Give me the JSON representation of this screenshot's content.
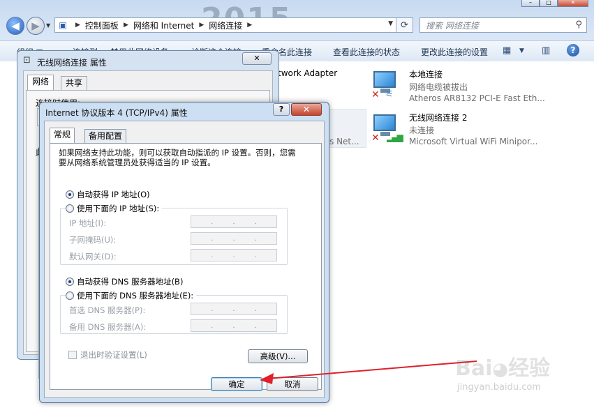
{
  "explorer": {
    "background_year": "2015",
    "address": {
      "crumbs": [
        "控制面板",
        "网络和 Internet",
        "网络连接"
      ]
    },
    "search": {
      "placeholder": "搜索 网络连接"
    },
    "toolbar": {
      "items": [
        "组织 ▼",
        "连接到",
        "禁用此网络设备",
        "诊断这个连接",
        "重命名此连接",
        "查看此连接的状态",
        "更改此连接的设置"
      ],
      "help": "?"
    },
    "adapters": [
      {
        "name": "本地连接",
        "status": "网络电缆被拔出",
        "device": "Atheros AR8132 PCI-E Fast Eth..."
      },
      {
        "name": "无线网络连接 2",
        "status": "未连接",
        "device": "Microsoft Virtual WiFi Minipor..."
      }
    ],
    "partial_adapter": {
      "line1": "twork Adapter",
      "line2": "s Net..."
    }
  },
  "wireless_dialog": {
    "title": "无线网络连接 属性",
    "tabs": [
      "网络",
      "共享"
    ],
    "connect_using_label": "连接时使用:",
    "items_label": "此"
  },
  "tcp_dialog": {
    "title": "Internet 协议版本 4 (TCP/IPv4) 属性",
    "tabs": [
      "常规",
      "备用配置"
    ],
    "description": "如果网络支持此功能，则可以获取自动指派的 IP 设置。否则，您需要从网络系统管理员处获得适当的 IP 设置。",
    "ip_auto": "自动获得 IP 地址(O)",
    "ip_manual": "使用下面的 IP 地址(S):",
    "ip_fields": [
      {
        "label": "IP 地址(I):"
      },
      {
        "label": "子网掩码(U):"
      },
      {
        "label": "默认网关(D):"
      }
    ],
    "dns_auto": "自动获得 DNS 服务器地址(B)",
    "dns_manual": "使用下面的 DNS 服务器地址(E):",
    "dns_fields": [
      {
        "label": "首选 DNS 服务器(P):"
      },
      {
        "label": "备用 DNS 服务器(A):"
      }
    ],
    "validate_label": "退出时验证设置(L)",
    "advanced_button": "高级(V)...",
    "ok_button": "确定",
    "cancel_button": "取消",
    "ip_auto_selected": true,
    "dns_auto_selected": true
  },
  "colors": {
    "annotation_arrow": "#e0202a"
  }
}
